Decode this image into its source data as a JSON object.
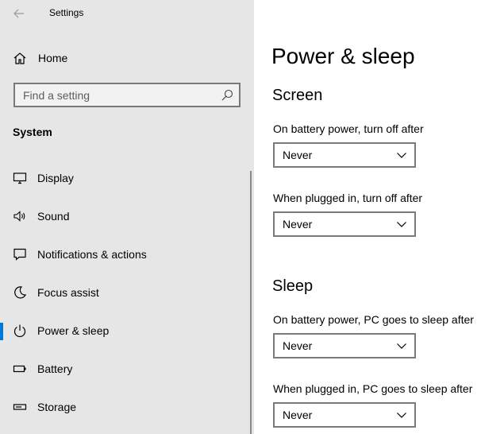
{
  "window": {
    "title": "Settings"
  },
  "sidebar": {
    "home_label": "Home",
    "search_placeholder": "Find a setting",
    "section": "System",
    "items": [
      {
        "label": "Display",
        "icon": "monitor-icon"
      },
      {
        "label": "Sound",
        "icon": "speaker-icon"
      },
      {
        "label": "Notifications & actions",
        "icon": "message-icon"
      },
      {
        "label": "Focus assist",
        "icon": "moon-icon"
      },
      {
        "label": "Power & sleep",
        "icon": "power-icon",
        "selected": true
      },
      {
        "label": "Battery",
        "icon": "battery-icon"
      },
      {
        "label": "Storage",
        "icon": "storage-icon"
      }
    ],
    "accent_color": "#0078d7"
  },
  "main": {
    "title": "Power & sleep",
    "screen": {
      "heading": "Screen",
      "battery_label": "On battery power, turn off after",
      "battery_value": "Never",
      "plugged_label": "When plugged in, turn off after",
      "plugged_value": "Never"
    },
    "sleep": {
      "heading": "Sleep",
      "battery_label": "On battery power, PC goes to sleep after",
      "battery_value": "Never",
      "plugged_label": "When plugged in, PC goes to sleep after",
      "plugged_value": "Never"
    }
  }
}
